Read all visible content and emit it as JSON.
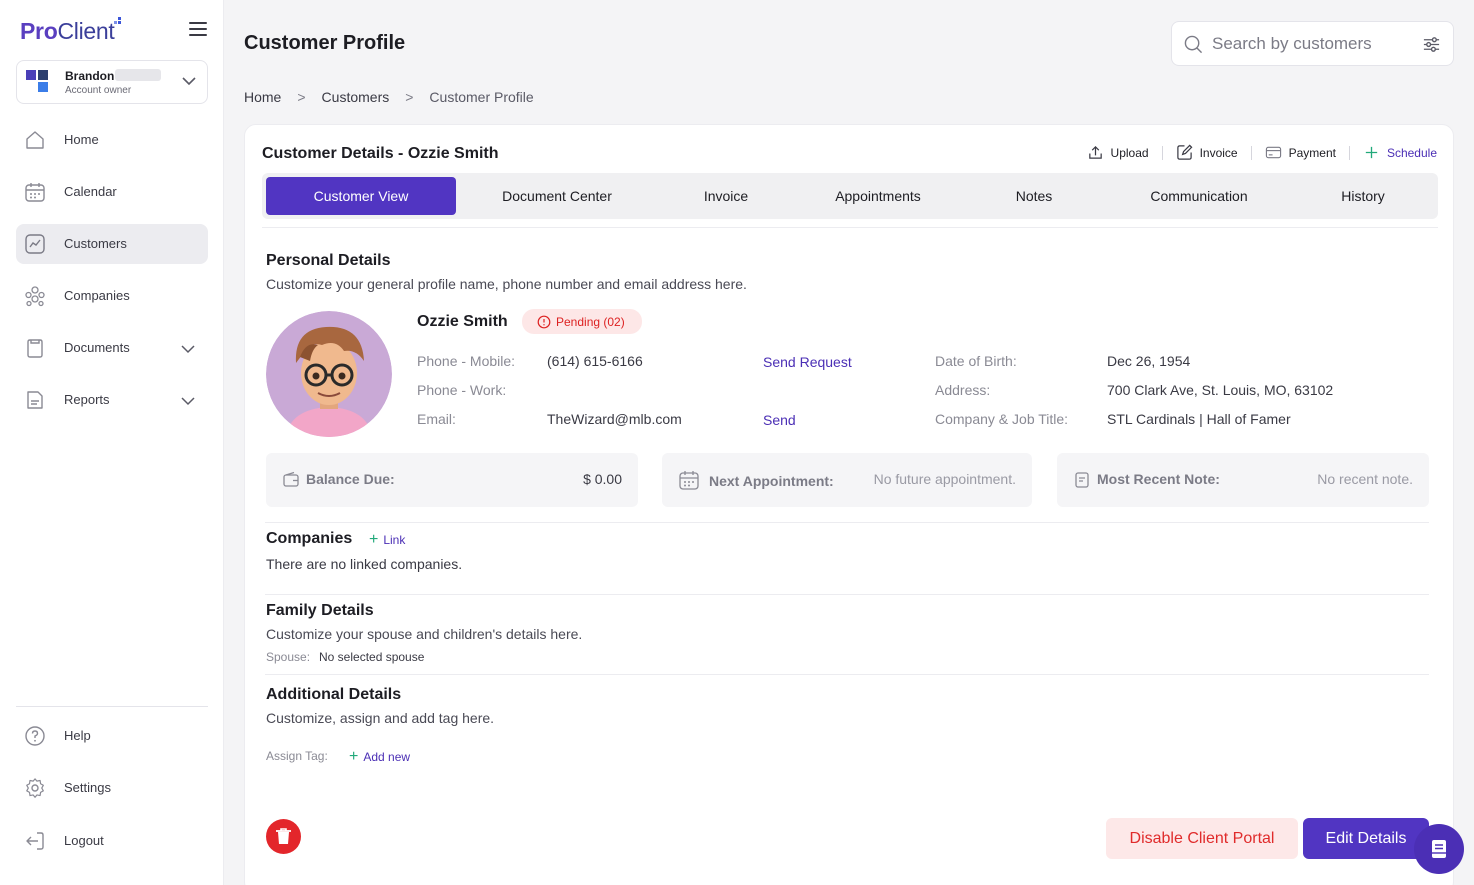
{
  "app": {
    "logo_pro": "Pro",
    "logo_client": "Client"
  },
  "account": {
    "name": "Brandon",
    "role": "Account owner"
  },
  "sidebar": {
    "items": [
      {
        "label": "Home",
        "icon": "home-icon"
      },
      {
        "label": "Calendar",
        "icon": "calendar-icon"
      },
      {
        "label": "Customers",
        "icon": "chart-icon",
        "active": true
      },
      {
        "label": "Companies",
        "icon": "companies-icon"
      },
      {
        "label": "Documents",
        "icon": "folder-icon",
        "expandable": true
      },
      {
        "label": "Reports",
        "icon": "report-icon",
        "expandable": true
      }
    ],
    "bottom": [
      {
        "label": "Help",
        "icon": "help-icon"
      },
      {
        "label": "Settings",
        "icon": "gear-icon"
      },
      {
        "label": "Logout",
        "icon": "logout-icon"
      }
    ]
  },
  "header": {
    "title": "Customer Profile",
    "search_placeholder": "Search by customers"
  },
  "breadcrumb": {
    "items": [
      "Home",
      "Customers",
      "Customer Profile"
    ],
    "separator": ">"
  },
  "card": {
    "title": "Customer Details - Ozzie Smith",
    "actions": {
      "upload": "Upload",
      "invoice": "Invoice",
      "payment": "Payment",
      "schedule": "Schedule"
    },
    "tabs": [
      "Customer View",
      "Document Center",
      "Invoice",
      "Appointments",
      "Notes",
      "Communication",
      "History"
    ],
    "active_tab": "Customer View"
  },
  "personal": {
    "title": "Personal Details",
    "desc": "Customize your general profile name, phone number and email address here.",
    "name": "Ozzie Smith",
    "badge": "Pending (02)",
    "phone_mobile_label": "Phone - Mobile:",
    "phone_mobile": "(614) 615-6166",
    "phone_work_label": "Phone - Work:",
    "email_label": "Email:",
    "email": "TheWizard@mlb.com",
    "send_request": "Send Request",
    "send": "Send",
    "dob_label": "Date of Birth:",
    "dob": "Dec 26, 1954",
    "address_label": "Address:",
    "address": "700 Clark Ave, St. Louis, MO, 63102",
    "company_label": "Company & Job Title:",
    "company": "STL Cardinals | Hall of Famer"
  },
  "stats": {
    "balance_label": "Balance Due:",
    "balance": "$ 0.00",
    "next_label": "Next Appointment:",
    "next": "No future appointment.",
    "note_label": "Most Recent Note:",
    "note": "No recent note."
  },
  "companies": {
    "title": "Companies",
    "link": "Link",
    "empty": "There are no linked companies."
  },
  "family": {
    "title": "Family Details",
    "desc": "Customize your spouse and children's details here.",
    "spouse_label": "Spouse:",
    "spouse": "No selected spouse"
  },
  "additional": {
    "title": "Additional Details",
    "desc": "Customize, assign and add tag here.",
    "tag_label": "Assign Tag:",
    "add_new": "Add new"
  },
  "buttons": {
    "disable_portal": "Disable Client Portal",
    "edit": "Edit Details"
  },
  "colors": {
    "accent": "#5135c2",
    "danger": "#e3262b",
    "success": "#21a97a"
  }
}
